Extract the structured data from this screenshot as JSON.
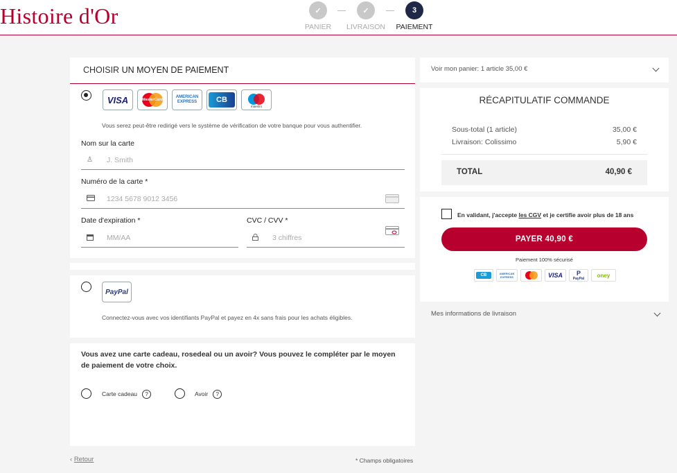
{
  "brand": {
    "logo_text": "Histoire d'Or",
    "accent": "#b8002e",
    "navy": "#1f2846"
  },
  "steps": [
    {
      "label": "PANIER",
      "state": "done",
      "icon": "check-icon"
    },
    {
      "label": "LIVRAISON",
      "state": "done",
      "icon": "check-icon"
    },
    {
      "label": "PAIEMENT",
      "state": "active",
      "number": "3"
    }
  ],
  "payment": {
    "title_prefix": "CHOISIR",
    "title_strong": "UN MOYEN DE PAIEMENT",
    "card_logos": [
      "VISA",
      "MasterCard",
      "AMERICAN EXPRESS",
      "CB",
      "maestro"
    ],
    "card_note": "Vous serez peut-être redirigé vers le système de vérification de votre banque pour vous authentifier.",
    "name_label": "Nom sur la carte",
    "name_placeholder": "J. Smith",
    "number_label": "Numéro de la carte *",
    "number_placeholder": "1234 5678 9012 3456",
    "expiry_label": "Date d'expiration *",
    "expiry_placeholder": "MM/AA",
    "cvc_label": "CVC / CVV *",
    "cvc_placeholder": "3 chiffres",
    "paypal_logo": "PayPal",
    "paypal_note": "Connectez-vous avec vos identifiants PayPal et payez en 4x sans frais pour les achats éligibles."
  },
  "gift": {
    "question": "Vous avez une carte cadeau, rosedeal ou un avoir? Vous pouvez le compléter par le moyen de paiement de votre choix.",
    "option_gift": "Carte cadeau",
    "option_credit": "Avoir",
    "help": "?"
  },
  "footer": {
    "back_chevron": "‹",
    "back_label": "Retour",
    "required_note": "* Champs obligatoires"
  },
  "cart": {
    "toggle_label": "Voir mon panier: 1 article 35,00 €",
    "summary_title": "RÉCAPITULATIF COMMANDE",
    "subtotal_label": "Sous-total (1 article)",
    "subtotal_value": "35,00 €",
    "shipping_label": "Livraison: Colissimo",
    "shipping_value": "5,90 €",
    "total_label": "TOTAL",
    "total_value": "40,90 €"
  },
  "checkout": {
    "terms_prefix": "En validant, j'accepte",
    "terms_link": "les CGV",
    "terms_suffix": "et je certifie avoir plus de 18 ans",
    "pay_button": "PAYER 40,90 €",
    "secure_note": "Paiement 100% sécurisé",
    "mini_logos": [
      "CB",
      "AMERICAN EXPRESS",
      "mastercard",
      "VISA",
      "PayPal",
      "oney"
    ]
  },
  "delivery_info": {
    "label": "Mes informations de livraison"
  }
}
